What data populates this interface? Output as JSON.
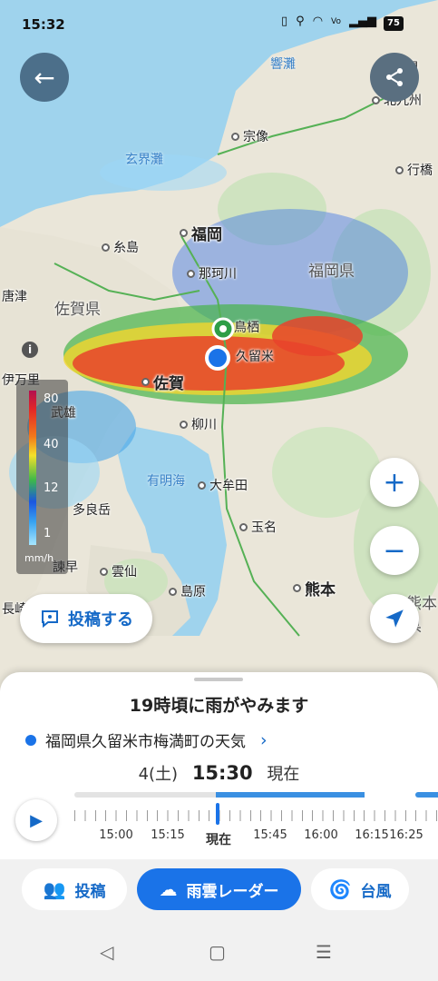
{
  "status": {
    "time": "15:32",
    "battery": "75",
    "icons": [
      "vibrate-icon",
      "location-icon",
      "wifi-icon",
      "volte-icon",
      "signal-icon"
    ]
  },
  "map": {
    "places": [
      {
        "name": "下関",
        "type": "city"
      },
      {
        "name": "北九州",
        "type": "city"
      },
      {
        "name": "宗像",
        "type": "city"
      },
      {
        "name": "行橋",
        "type": "city"
      },
      {
        "name": "糸島",
        "type": "city"
      },
      {
        "name": "福岡",
        "type": "major"
      },
      {
        "name": "那珂川",
        "type": "city"
      },
      {
        "name": "鳥栖",
        "type": "city"
      },
      {
        "name": "久留米",
        "type": "city"
      },
      {
        "name": "佐賀",
        "type": "major"
      },
      {
        "name": "柳川",
        "type": "city"
      },
      {
        "name": "武雄",
        "type": "city"
      },
      {
        "name": "大牟田",
        "type": "city"
      },
      {
        "name": "玉名",
        "type": "city"
      },
      {
        "name": "多良岳",
        "type": "mountain"
      },
      {
        "name": "諫早",
        "type": "city"
      },
      {
        "name": "雲仙",
        "type": "city"
      },
      {
        "name": "島原",
        "type": "city"
      },
      {
        "name": "熊本",
        "type": "major"
      },
      {
        "name": "伊万里",
        "type": "city"
      },
      {
        "name": "唐津",
        "type": "city"
      },
      {
        "name": "長崎",
        "type": "city"
      }
    ],
    "regions": [
      "福岡県",
      "佐賀県",
      "熊本県"
    ],
    "seas": [
      "響灘",
      "玄界灘",
      "有明海"
    ],
    "legend": {
      "labels": [
        "80",
        "40",
        "12",
        "1"
      ],
      "unit": "mm/h"
    },
    "post_button": "投稿する",
    "zoom_in": "+",
    "zoom_out": "−"
  },
  "sheet": {
    "rain_stop": "19時頃に雨がやみます",
    "location": "福岡県久留米市梅満町の天気",
    "date": "4(土)",
    "time": "15:30",
    "now_label": "現在",
    "timeline": {
      "labels": [
        "15:00",
        "15:15",
        "現在",
        "15:45",
        "16:00",
        "16:15",
        "16:25"
      ],
      "current_index": 2
    }
  },
  "nav": {
    "items": [
      {
        "label": "投稿",
        "icon": "people-icon",
        "active": false
      },
      {
        "label": "雨雲レーダー",
        "icon": "rain-cloud-icon",
        "active": true
      },
      {
        "label": "台風",
        "icon": "typhoon-icon",
        "active": false
      }
    ]
  },
  "colors": {
    "accent": "#1a73e8",
    "sea": "#9fd3ed",
    "land": "#eae6d9"
  }
}
